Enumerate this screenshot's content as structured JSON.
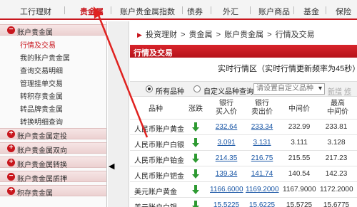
{
  "topnav": {
    "items": [
      "工行理财",
      "贵金属",
      "账户贵金属指数",
      "债券",
      "外汇",
      "账户商品",
      "基金",
      "保险"
    ],
    "active": "贵金属"
  },
  "sidebar": {
    "sections": [
      {
        "label": "账户贵金属",
        "icon": "minus",
        "sub": [
          "行情及交易",
          "我的账户贵金属",
          "查询交易明细",
          "管理挂单交易",
          "转积存贵金属",
          "转品牌贵金属",
          "转换明细查询"
        ],
        "active_sub": "行情及交易"
      },
      {
        "label": "账户贵金属定投",
        "icon": "plus"
      },
      {
        "label": "账户贵金属双向",
        "icon": "plus"
      },
      {
        "label": "账户贵金属转换",
        "icon": "plus"
      },
      {
        "label": "账户贵金属质押",
        "icon": "minus"
      },
      {
        "label": "积存贵金属",
        "icon": "plus"
      }
    ]
  },
  "breadcrumb": {
    "marker": "▶",
    "items": [
      "投资理财",
      "贵金属",
      "账户贵金属",
      "行情及交易"
    ],
    "separator": ">"
  },
  "panel": {
    "title": "行情及交易",
    "realtime_label": "实时行情区（实时行情更新频率为45秒）"
  },
  "filter": {
    "all_label": "所有品种",
    "custom_label": "自定义品种查询",
    "select_placeholder": "请设置自定义品种",
    "add_link": "新增",
    "edit_link": "修改"
  },
  "table": {
    "headers": {
      "name": "品种",
      "trend": "涨跌",
      "bank_buy": "银行\n买入价",
      "bank_sell": "银行\n卖出价",
      "mid": "中间价",
      "high": "最高\n中间价"
    },
    "rows": [
      {
        "name": "人民币账户黄金",
        "trend": "down",
        "buy": "232.64",
        "sell": "233.34",
        "mid": "232.99",
        "high": "233.81"
      },
      {
        "name": "人民币账户白银",
        "trend": "down",
        "buy": "3.091",
        "sell": "3.131",
        "mid": "3.111",
        "high": "3.128"
      },
      {
        "name": "人民币账户铂金",
        "trend": "down",
        "buy": "214.35",
        "sell": "216.75",
        "mid": "215.55",
        "high": "217.23"
      },
      {
        "name": "人民币账户钯金",
        "trend": "down",
        "buy": "139.34",
        "sell": "141.74",
        "mid": "140.54",
        "high": "142.23"
      },
      {
        "name": "美元账户黄金",
        "trend": "down",
        "buy": "1166.6000",
        "sell": "1169.2000",
        "mid": "1167.9000",
        "high": "1172.2000"
      },
      {
        "name": "美元账户白银",
        "trend": "down",
        "buy": "15.5225",
        "sell": "15.6225",
        "mid": "15.5725",
        "high": "15.6775"
      }
    ]
  },
  "colors": {
    "brand_red": "#c8161d",
    "link_blue": "#1a57a6",
    "down_green": "#2e9a32"
  }
}
